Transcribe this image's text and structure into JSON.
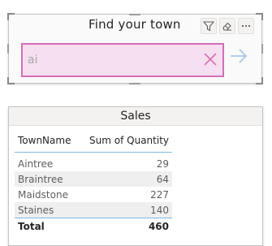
{
  "search": {
    "title": "Find your town",
    "value": "ai",
    "input_bg": "#f6dff0",
    "input_border": "#d36fb5",
    "icons": [
      "filter-icon",
      "eraser-icon",
      "more-options-icon",
      "clear-icon",
      "arrow-right-icon"
    ],
    "arrow_color": "#a9c8e8"
  },
  "sales": {
    "title": "Sales",
    "columns": [
      "TownName",
      "Sum of Quantity"
    ],
    "rows": [
      {
        "name": "Aintree",
        "qty": "29"
      },
      {
        "name": "Braintree",
        "qty": "64"
      },
      {
        "name": "Maidstone",
        "qty": "227"
      },
      {
        "name": "Staines",
        "qty": "140"
      }
    ],
    "total": {
      "label": "Total",
      "qty": "460"
    },
    "accent": "#7fbae0"
  }
}
